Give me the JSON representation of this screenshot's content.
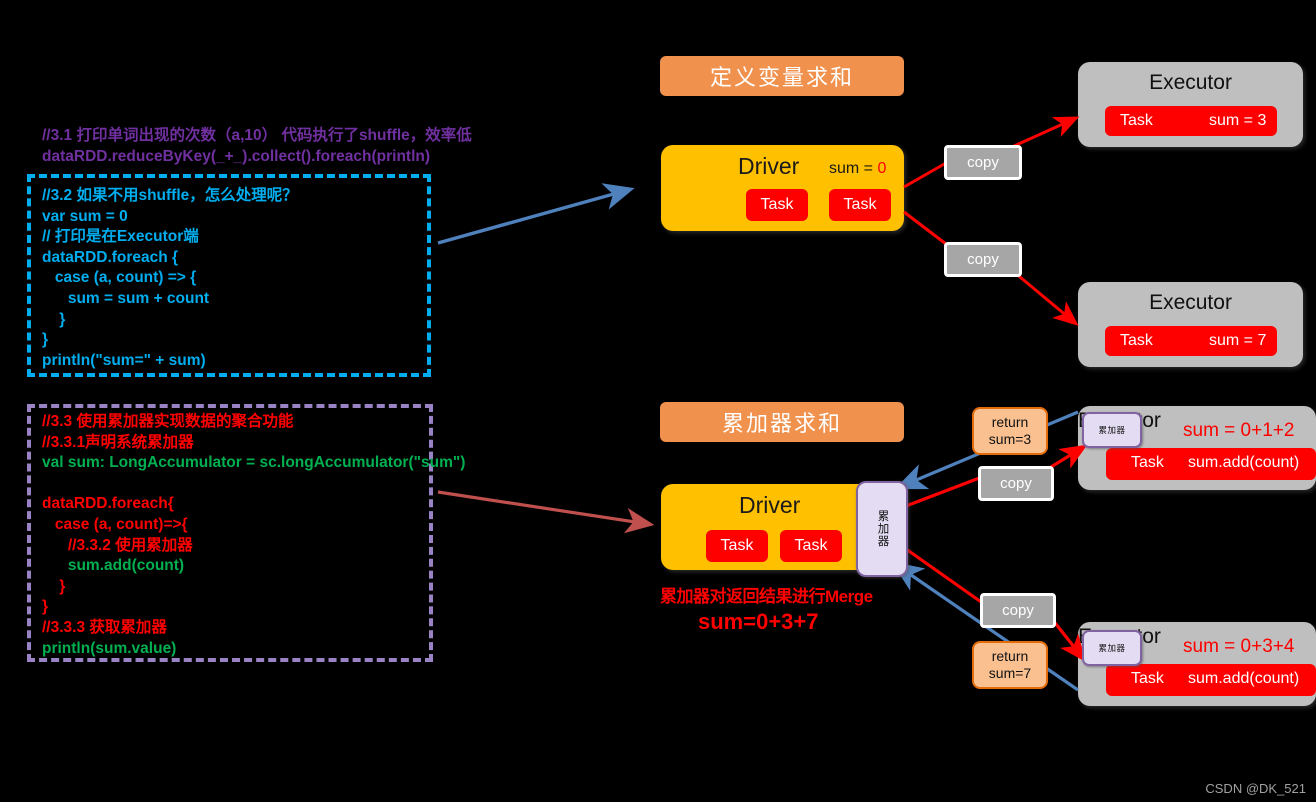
{
  "watermark": "CSDN @DK_521",
  "code_block_1": {
    "preamble": [
      "//3.1 打印单词出现的次数（a,10） 代码执行了shuffle，效率低",
      "dataRDD.reduceByKey(_+_).collect().foreach(println)"
    ],
    "body": [
      "//3.2 如果不用shuffle，怎么处理呢？",
      "var sum = 0",
      "// 打印是在Executor端",
      "dataRDD.foreach {",
      "   case (a, count) => {",
      "      sum = sum + count",
      "    }",
      "}",
      "println(\"sum=\" + sum)"
    ]
  },
  "code_block_2": {
    "lines": [
      "//3.3 使用累加器实现数据的聚合功能",
      "//3.3.1声明系统累加器",
      "val sum: LongAccumulator = sc.longAccumulator(\"sum\")",
      "",
      "dataRDD.foreach{",
      "   case (a, count)=>{",
      "      //3.3.2 使用累加器",
      "      sum.add(count)",
      "    }",
      "}",
      "//3.3.3 获取累加器",
      "println(sum.value)"
    ]
  },
  "top_section": {
    "header": "定义变量求和",
    "driver": {
      "title": "Driver",
      "sum_label": "sum =",
      "sum_value": "0",
      "task_1": "Task",
      "task_2": "Task"
    },
    "copy_1": "copy",
    "copy_2": "copy",
    "executor_1": {
      "title": "Executor",
      "task": "Task",
      "sum": "sum = 3"
    },
    "executor_2": {
      "title": "Executor",
      "task": "Task",
      "sum": "sum = 7"
    }
  },
  "bottom_section": {
    "header": "累加器求和",
    "driver": {
      "title": "Driver",
      "task_1": "Task",
      "task_2": "Task",
      "accumulator_label": "累加器"
    },
    "merge_note_title": "累加器对返回结果进行Merge",
    "merge_note_sum": "sum=0+3+7",
    "copy_1": "copy",
    "copy_2": "copy",
    "return_1": {
      "line1": "return",
      "line2": "sum=3"
    },
    "return_2": {
      "line1": "return",
      "line2": "sum=7"
    },
    "executor_1": {
      "title": "Executor",
      "accumulator_label": "累加器",
      "sum_expr": "sum = 0+1+2",
      "task": "Task",
      "task_expr": "sum.add(count)"
    },
    "executor_2": {
      "title": "Executor",
      "accumulator_label": "累加器",
      "sum_expr": "sum = 0+3+4",
      "task": "Task",
      "task_expr": "sum.add(count)"
    }
  },
  "colors": {
    "background": "#000000",
    "header_orange": "#F0924E",
    "driver_yellow": "#FFC000",
    "task_red": "#FF0000",
    "executor_grey": "#BFBFBF",
    "copy_grey": "#A6A6A6",
    "return_peach": "#FAC090",
    "accumulator_lavender": "#E3DCF2",
    "code1_border": "#00AEEF",
    "code2_border": "#9983C4",
    "arrow_blue": "#4F81BD",
    "arrow_darkred": "#C0504D",
    "arrow_red": "#FF0000",
    "code_purple": "#7030A0",
    "code_green": "#00B050"
  }
}
